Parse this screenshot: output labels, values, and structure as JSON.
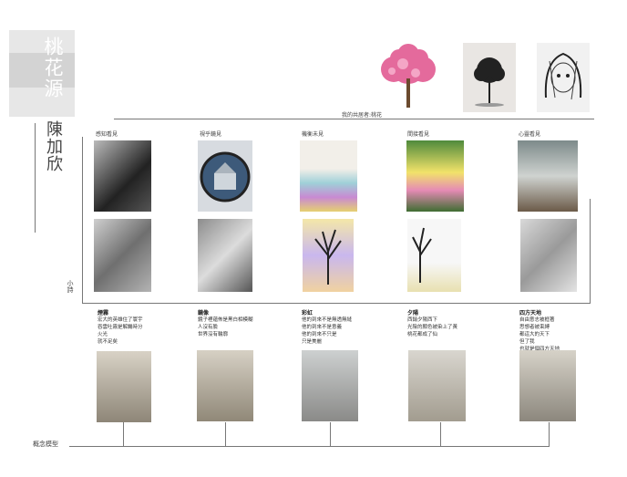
{
  "title": "桃花源",
  "author": "陳加欣",
  "top_caption": "我的共居者:桃花",
  "columns": [
    {
      "heading": "感知看見",
      "poem_title": "煙霧",
      "poem_lines": [
        "宏大的英雄住了寰宇",
        "吞雲吐霧是解饑時分",
        "火光",
        "就不足矣"
      ]
    },
    {
      "heading": "視乎鏡見",
      "poem_title": "鏡像",
      "poem_lines": [
        "鏡子裡蘊佈是黑白相模糊",
        "人沒有臉",
        "世界沒有輪廓"
      ]
    },
    {
      "heading": "機衡未見",
      "poem_title": "彩虹",
      "poem_lines": [
        "他的到來不是無透無縫",
        "他的到來不是意義",
        "他的到來不只是",
        "只是美麗"
      ]
    },
    {
      "heading": "間接看見",
      "poem_title": "夕陽",
      "poem_lines": [
        "西銷夕陽西下",
        "光陰的顏色被染上了黃",
        "桃花都成了仙"
      ]
    },
    {
      "heading": "心靈看見",
      "poem_title": "四方天地",
      "poem_lines": [
        "自由意志被框著",
        "思想者被束縛",
        "都這大的天下",
        "但了我",
        "也就是個四方天地"
      ]
    }
  ],
  "side_label": "小詩",
  "bottom_label": "概念模型",
  "colors": {
    "accent_pink": "#e46a9c",
    "line": "#777777",
    "band": "#e7e7e7"
  }
}
